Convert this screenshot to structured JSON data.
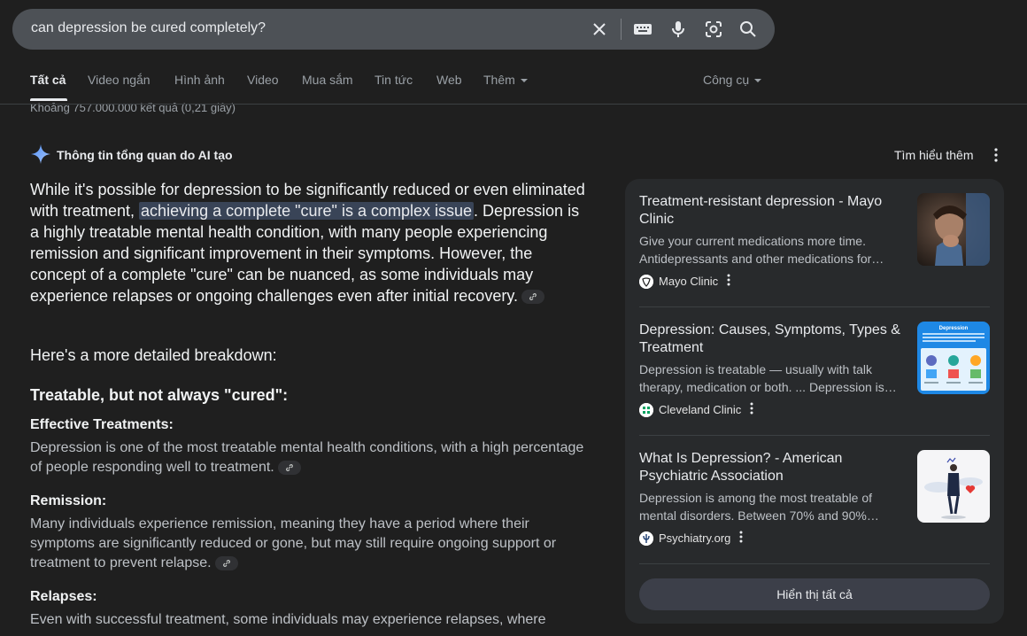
{
  "search": {
    "query": "can depression be cured completely?"
  },
  "tabs": [
    {
      "label": "Tất cả"
    },
    {
      "label": "Video ngắn"
    },
    {
      "label": "Hình ảnh"
    },
    {
      "label": "Video"
    },
    {
      "label": "Mua sắm"
    },
    {
      "label": "Tin tức"
    },
    {
      "label": "Web"
    },
    {
      "label": "Thêm"
    }
  ],
  "tools_label": "Công cụ",
  "results_count": "Khoảng 757.000.000 kết quả (0,21 giây)",
  "ai_overview": {
    "title": "Thông tin tổng quan do AI tạo",
    "learn_more": "Tìm hiểu thêm",
    "lead_before": "While it's possible for depression to be significantly reduced or even eliminated with treatment, ",
    "lead_highlight": "achieving a complete \"cure\" is a complex issue",
    "lead_after": ". Depression is a highly treatable mental health condition, with many people experiencing remission and significant improvement in their symptoms. However, the concept of a complete \"cure\" can be nuanced, as some individuals may experience relapses or ongoing challenges even after initial recovery.",
    "breakdown": "Here's a more detailed breakdown:",
    "heading": "Treatable, but not always \"cured\":",
    "sections": [
      {
        "title": "Effective Treatments:",
        "body": "Depression is one of the most treatable mental health conditions, with a high percentage of people responding well to treatment."
      },
      {
        "title": "Remission:",
        "body": "Many individuals experience remission, meaning they have a period where their symptoms are significantly reduced or gone, but may still require ongoing support or treatment to prevent relapse."
      },
      {
        "title": "Relapses:",
        "body": "Even with successful treatment, some individuals may experience relapses, where"
      }
    ]
  },
  "sources": [
    {
      "title": "Treatment-resistant depression - Mayo Clinic",
      "snippet": "Give your current medications more time. Antidepressants and other medications for…",
      "source": "Mayo Clinic"
    },
    {
      "title": "Depression: Causes, Symptoms, Types & Treatment",
      "snippet": "Depression is treatable — usually with talk therapy, medication or both. ... Depression is…",
      "source": "Cleveland Clinic",
      "thumb_title": "Depression"
    },
    {
      "title": "What Is Depression? - American Psychiatric Association",
      "snippet": "Depression is among the most treatable of mental disorders. Between 70% and 90%…",
      "source": "Psychiatry.org"
    }
  ],
  "show_all": "Hiển thị tất cả",
  "colors": {
    "background": "#1f1f1f",
    "searchbar": "#4d5156",
    "panel": "#282a2c",
    "highlight": "#394457",
    "ai_sparkle": "#8ab4f8"
  },
  "icons": [
    "close-icon",
    "keyboard-icon",
    "mic-icon",
    "lens-icon",
    "search-icon",
    "sparkle-icon",
    "link-icon",
    "kebab-icon"
  ]
}
